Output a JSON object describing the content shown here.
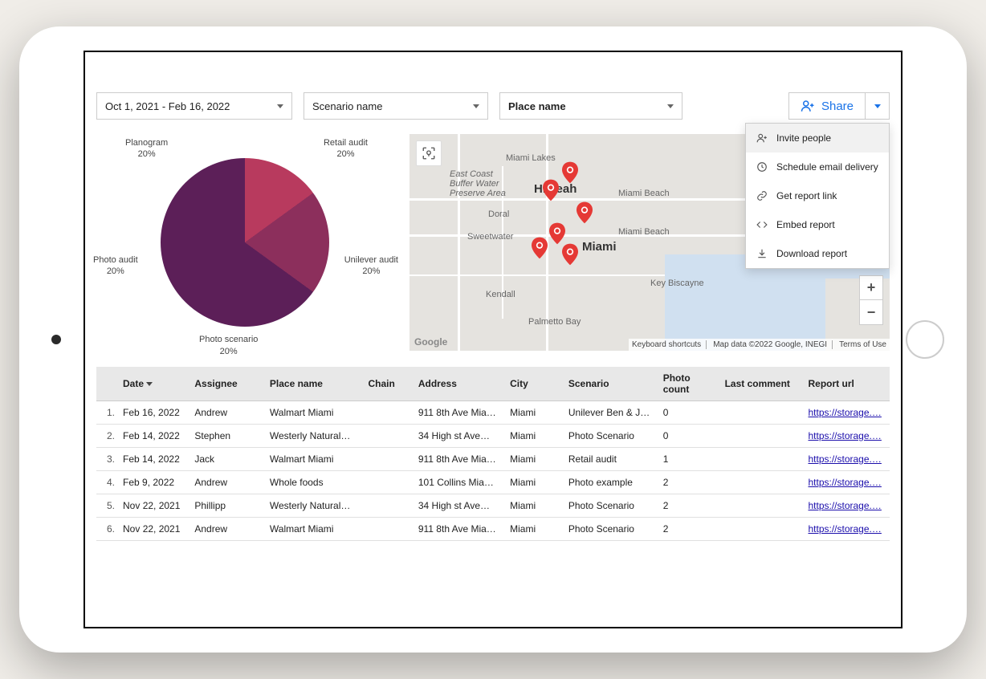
{
  "filters": {
    "date_range": "Oct 1, 2021 - Feb 16, 2022",
    "scenario_label": "Scenario name",
    "place_label": "Place name"
  },
  "share": {
    "button_label": "Share",
    "menu": {
      "invite": "Invite people",
      "schedule": "Schedule email delivery",
      "link": "Get report link",
      "embed": "Embed report",
      "download": "Download report"
    }
  },
  "chart_data": {
    "type": "pie",
    "title": "",
    "series": [
      {
        "name": "Planogram",
        "value": 20,
        "percent_label": "20%",
        "color": "#3d1a4a"
      },
      {
        "name": "Retail audit",
        "value": 20,
        "percent_label": "20%",
        "color": "#f5a02b"
      },
      {
        "name": "Unilever audit",
        "value": 20,
        "percent_label": "20%",
        "color": "#b83a5e"
      },
      {
        "name": "Photo scenario",
        "value": 20,
        "percent_label": "20%",
        "color": "#8c2f5c"
      },
      {
        "name": "Photo audit",
        "value": 20,
        "percent_label": "20%",
        "color": "#5c1f58"
      }
    ]
  },
  "map": {
    "labels": {
      "miami": "Miami",
      "miami_lakes": "Miami Lakes",
      "hialeah": "Hialeah",
      "miami_beach": "Miami Beach",
      "miami_beach2": "Miami Beach",
      "doral": "Doral",
      "sweetwater": "Sweetwater",
      "kendall": "Kendall",
      "palmetto_bay": "Palmetto Bay",
      "key_biscayne": "Key Biscayne",
      "east_coast": "East Coast\nBuffer Water\nPreserve Area"
    },
    "attrib": {
      "shortcuts": "Keyboard shortcuts",
      "data": "Map data ©2022 Google, INEGI",
      "terms": "Terms of Use"
    },
    "google": "Google"
  },
  "table": {
    "headers": {
      "date": "Date",
      "assignee": "Assignee",
      "place": "Place name",
      "chain": "Chain",
      "address": "Address",
      "city": "City",
      "scenario": "Scenario",
      "photo_count": "Photo count",
      "last_comment": "Last comment",
      "report_url": "Report url"
    },
    "rows": [
      {
        "idx": "1.",
        "date": "Feb 16, 2022",
        "assignee": "Andrew",
        "place": "Walmart Miami",
        "chain": "",
        "address": "911 8th Ave Mia…",
        "city": "Miami",
        "scenario": "Unilever Ben & J…",
        "photo_count": "0",
        "last_comment": "",
        "report_url": "https://storage.…"
      },
      {
        "idx": "2.",
        "date": "Feb 14, 2022",
        "assignee": "Stephen",
        "place": "Westerly Natural…",
        "chain": "",
        "address": "34 High st Ave…",
        "city": "Miami",
        "scenario": "Photo Scenario",
        "photo_count": "0",
        "last_comment": "",
        "report_url": "https://storage.…"
      },
      {
        "idx": "3.",
        "date": "Feb 14, 2022",
        "assignee": "Jack",
        "place": "Walmart Miami",
        "chain": "",
        "address": "911 8th Ave Mia…",
        "city": "Miami",
        "scenario": "Retail audit",
        "photo_count": "1",
        "last_comment": "",
        "report_url": "https://storage.…"
      },
      {
        "idx": "4.",
        "date": "Feb 9, 2022",
        "assignee": "Andrew",
        "place": "Whole foods",
        "chain": "",
        "address": "101 Collins Mia…",
        "city": "Miami",
        "scenario": "Photo example",
        "photo_count": "2",
        "last_comment": "",
        "report_url": "https://storage.…"
      },
      {
        "idx": "5.",
        "date": "Nov 22, 2021",
        "assignee": "Phillipp",
        "place": "Westerly Natural…",
        "chain": "",
        "address": "34 High st Ave…",
        "city": "Miami",
        "scenario": "Photo Scenario",
        "photo_count": "2",
        "last_comment": "",
        "report_url": "https://storage.…"
      },
      {
        "idx": "6.",
        "date": "Nov 22, 2021",
        "assignee": "Andrew",
        "place": "Walmart Miami",
        "chain": "",
        "address": "911 8th Ave Mia…",
        "city": "Miami",
        "scenario": "Photo Scenario",
        "photo_count": "2",
        "last_comment": "",
        "report_url": "https://storage.…"
      }
    ]
  }
}
